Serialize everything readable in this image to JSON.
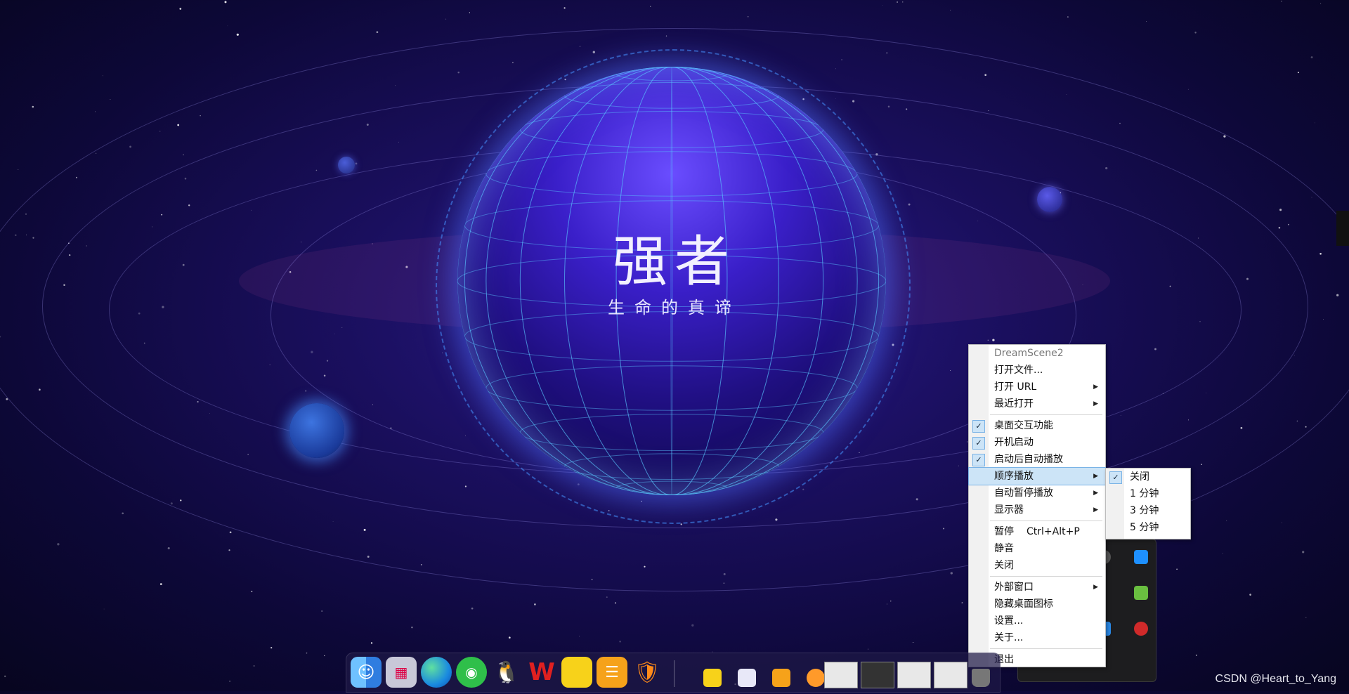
{
  "wallpaper": {
    "title": "强者",
    "subtitle": "生命的真谛"
  },
  "context_menu": {
    "items": [
      {
        "label": "DreamScene2",
        "type": "header"
      },
      {
        "label": "打开文件...",
        "type": "item"
      },
      {
        "label": "打开 URL",
        "type": "submenu"
      },
      {
        "label": "最近打开",
        "type": "submenu"
      },
      {
        "type": "separator"
      },
      {
        "label": "桌面交互功能",
        "type": "check",
        "checked": true
      },
      {
        "label": "开机启动",
        "type": "check",
        "checked": true
      },
      {
        "label": "启动后自动播放",
        "type": "check",
        "checked": true
      },
      {
        "label": "顺序播放",
        "type": "submenu",
        "highlighted": true
      },
      {
        "label": "自动暂停播放",
        "type": "submenu"
      },
      {
        "label": "显示器",
        "type": "submenu"
      },
      {
        "type": "separator"
      },
      {
        "label": "暂停",
        "shortcut": "Ctrl+Alt+P",
        "type": "item"
      },
      {
        "label": "静音",
        "type": "item"
      },
      {
        "label": "关闭",
        "type": "item"
      },
      {
        "type": "separator"
      },
      {
        "label": "外部窗口",
        "type": "submenu"
      },
      {
        "label": "隐藏桌面图标",
        "type": "item"
      },
      {
        "label": "设置...",
        "type": "item"
      },
      {
        "label": "关于...",
        "type": "item"
      },
      {
        "type": "separator"
      },
      {
        "label": "退出",
        "type": "item"
      }
    ]
  },
  "submenu": {
    "items": [
      {
        "label": "关闭",
        "checked": true
      },
      {
        "label": "1 分钟",
        "checked": false
      },
      {
        "label": "3 分钟",
        "checked": false
      },
      {
        "label": "5 分钟",
        "checked": false
      }
    ]
  },
  "dock": {
    "apps": [
      "finder-icon",
      "launchpad-icon",
      "edge-icon",
      "wechat-icon",
      "qq-icon",
      "wps-icon",
      "sticky-notes-icon",
      "reminders-icon",
      "fire-shield-icon"
    ]
  },
  "watermark": "CSDN @Heart_to_Yang",
  "colors": {
    "menu_highlight": "#cce4f7",
    "background_deep": "#0d0838",
    "globe": "#3a1fc9"
  }
}
